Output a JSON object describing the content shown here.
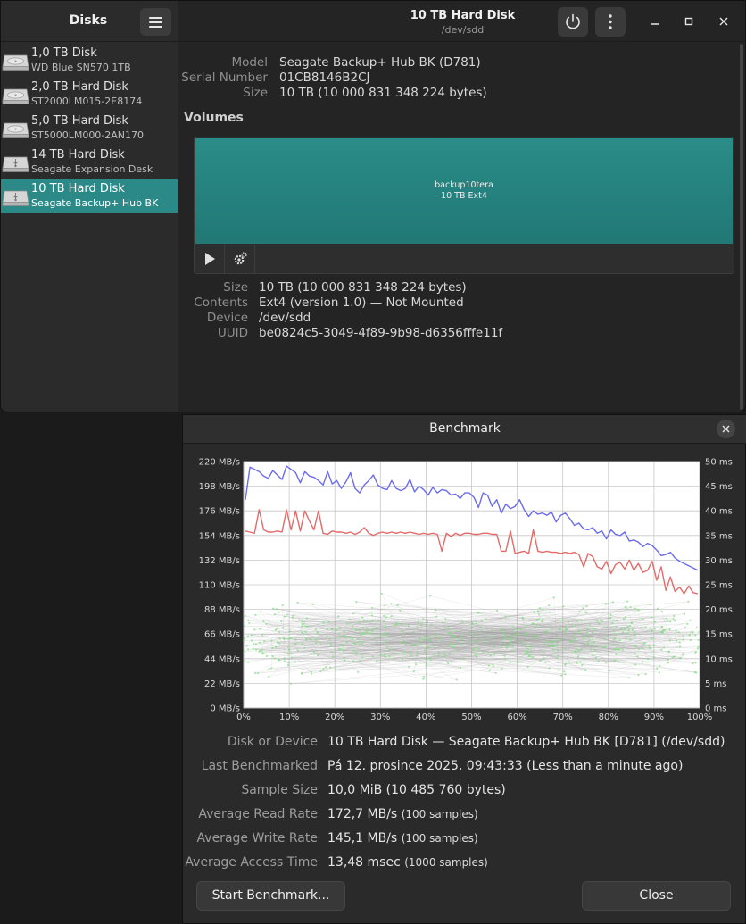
{
  "disks_app": {
    "sidebar_title": "Disks",
    "drives": [
      {
        "name": "1,0 TB Disk",
        "model": "WD Blue SN570 1TB",
        "icon": "hard-disk-icon",
        "selected": false
      },
      {
        "name": "2,0 TB Hard Disk",
        "model": "ST2000LM015-2E8174",
        "icon": "hard-disk-icon",
        "selected": false
      },
      {
        "name": "5,0 TB Hard Disk",
        "model": "ST5000LM000-2AN170",
        "icon": "hard-disk-icon",
        "selected": false
      },
      {
        "name": "14 TB Hard Disk",
        "model": "Seagate Expansion Desk",
        "icon": "usb-disk-icon",
        "selected": false
      },
      {
        "name": "10 TB Hard Disk",
        "model": "Seagate Backup+ Hub BK",
        "icon": "usb-disk-icon",
        "selected": true
      }
    ],
    "header": {
      "title": "10 TB Hard Disk",
      "subtitle": "/dev/sdd"
    },
    "drive_info": [
      {
        "key": "Model",
        "value": "Seagate Backup+ Hub BK (D781)"
      },
      {
        "key": "Serial Number",
        "value": "01CB8146B2CJ"
      },
      {
        "key": "Size",
        "value": "10 TB (10 000 831 348 224 bytes)"
      }
    ],
    "volumes_heading": "Volumes",
    "volume": {
      "name": "backup10tera",
      "subtitle": "10 TB Ext4"
    },
    "volume_info": [
      {
        "key": "Size",
        "value": "10 TB (10 000 831 348 224 bytes)"
      },
      {
        "key": "Contents",
        "value": "Ext4 (version 1.0) — Not Mounted"
      },
      {
        "key": "Device",
        "value": "/dev/sdd"
      },
      {
        "key": "UUID",
        "value": "be0824c5-3049-4f89-9b98-d6356fffe11f"
      }
    ],
    "colors": {
      "accent": "#2b8a87",
      "volume": "#26827f"
    }
  },
  "benchmark": {
    "title": "Benchmark",
    "stats": [
      {
        "key": "Disk or Device",
        "value": "10 TB Hard Disk — Seagate Backup+ Hub BK [D781] (/dev/sdd)",
        "note": ""
      },
      {
        "key": "Last Benchmarked",
        "value": "Pá 12. prosince 2025, 09:43:33 (Less than a minute ago)",
        "note": ""
      },
      {
        "key": "Sample Size",
        "value": "10,0 MiB (10 485 760 bytes)",
        "note": ""
      },
      {
        "key": "Average Read Rate",
        "value": "172,7 MB/s",
        "note": "(100 samples)"
      },
      {
        "key": "Average Write Rate",
        "value": "145,1 MB/s",
        "note": "(100 samples)"
      },
      {
        "key": "Average Access Time",
        "value": "13,48 msec",
        "note": "(1000 samples)"
      }
    ],
    "start_button": "Start Benchmark...",
    "close_button": "Close"
  },
  "chart_data": {
    "type": "line",
    "x_unit": "%",
    "x_ticks": [
      "0%",
      "10%",
      "20%",
      "30%",
      "40%",
      "50%",
      "60%",
      "70%",
      "80%",
      "90%",
      "100%"
    ],
    "y_left_ticks": [
      "0 MB/s",
      "22 MB/s",
      "44 MB/s",
      "66 MB/s",
      "88 MB/s",
      "110 MB/s",
      "132 MB/s",
      "154 MB/s",
      "176 MB/s",
      "198 MB/s",
      "220 MB/s"
    ],
    "y_right_ticks": [
      "0 ms",
      "5 ms",
      "10 ms",
      "15 ms",
      "20 ms",
      "25 ms",
      "30 ms",
      "35 ms",
      "40 ms",
      "45 ms",
      "50 ms"
    ],
    "y_left_range": [
      0,
      220
    ],
    "y_right_range": [
      0,
      50
    ],
    "grid": true,
    "series": [
      {
        "color": "#6b6bf0",
        "values": [
          186,
          215,
          213,
          211,
          207,
          205,
          212,
          208,
          204,
          216,
          213,
          210,
          201,
          211,
          207,
          206,
          203,
          199,
          211,
          200,
          203,
          196,
          202,
          210,
          196,
          192,
          199,
          203,
          208,
          199,
          196,
          195,
          203,
          196,
          194,
          196,
          204,
          193,
          198,
          195,
          190,
          197,
          192,
          195,
          194,
          190,
          191,
          187,
          192,
          192,
          188,
          179,
          192,
          190,
          180,
          186,
          174,
          182,
          178,
          180,
          186,
          177,
          171,
          176,
          173,
          174,
          172,
          175,
          166,
          172,
          174,
          169,
          163,
          165,
          160,
          159,
          161,
          156,
          158,
          151,
          159,
          155,
          154,
          157,
          149,
          150,
          148,
          144,
          147,
          145,
          141,
          136,
          137,
          139,
          134,
          131,
          129,
          127,
          125,
          123
        ]
      },
      {
        "color": "#e46a6a",
        "values": [
          158,
          157,
          156,
          177,
          159,
          157,
          157,
          158,
          157,
          177,
          159,
          176,
          158,
          176,
          167,
          159,
          176,
          156,
          155,
          158,
          157,
          157,
          156,
          157,
          155,
          157,
          161,
          156,
          154,
          156,
          157,
          156,
          157,
          156,
          157,
          156,
          157,
          156,
          155,
          156,
          155,
          156,
          155,
          140,
          156,
          153,
          156,
          154,
          156,
          156,
          155,
          155,
          156,
          156,
          155,
          155,
          140,
          140,
          158,
          138,
          139,
          140,
          138,
          159,
          140,
          139,
          140,
          139,
          139,
          138,
          139,
          138,
          139,
          137,
          126,
          138,
          135,
          126,
          124,
          131,
          120,
          128,
          130,
          124,
          132,
          123,
          129,
          121,
          123,
          131,
          114,
          126,
          105,
          117,
          104,
          108,
          102,
          109,
          103,
          102
        ]
      }
    ]
  }
}
